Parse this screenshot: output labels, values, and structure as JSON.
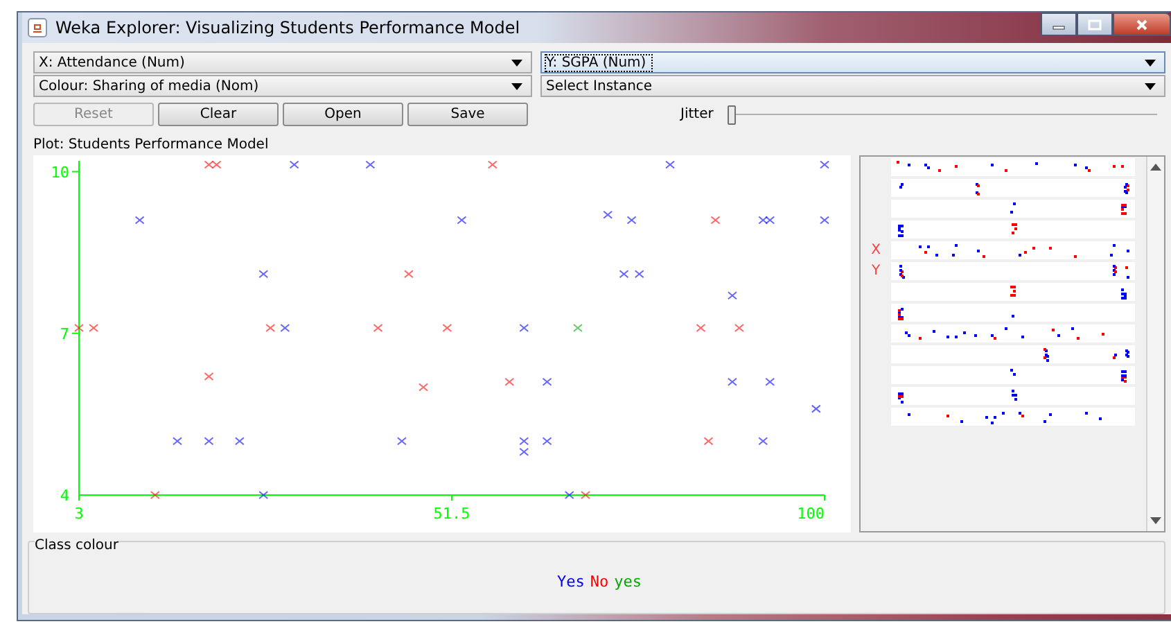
{
  "window": {
    "title": "Weka Explorer: Visualizing Students Performance Model"
  },
  "selectors": [
    {
      "kind": "dropdown",
      "value": "X: Attendance (Num)",
      "focused": false
    },
    {
      "kind": "dropdown",
      "value": "Y: SGPA (Num)",
      "focused": true
    },
    {
      "kind": "dropdown",
      "value": "Colour: Sharing of media (Nom)",
      "focused": false
    },
    {
      "kind": "dropdown",
      "value": "Select Instance",
      "focused": false
    }
  ],
  "buttons": [
    {
      "label": "Reset",
      "disabled": true
    },
    {
      "label": "Clear",
      "disabled": false
    },
    {
      "label": "Open",
      "disabled": false
    },
    {
      "label": "Save",
      "disabled": false
    }
  ],
  "jitter": {
    "label": "Jitter",
    "level": 0
  },
  "plot": {
    "title": "Plot: Students Performance Model",
    "chart_data": {
      "type": "scatter",
      "xlim": [
        3,
        100
      ],
      "ylim": [
        4,
        10.2
      ],
      "xticks": [
        {
          "value": 3,
          "label": "3"
        },
        {
          "value": 51.5,
          "label": "51.5"
        },
        {
          "value": 100,
          "label": "100"
        }
      ],
      "yticks": [
        {
          "value": 4,
          "label": "4"
        },
        {
          "value": 7,
          "label": "7"
        },
        {
          "value": 10,
          "label": "10"
        }
      ],
      "series": [
        {
          "name": "Yes",
          "color": "#0000ff",
          "x": [
            31,
            40.9,
            79.9,
            100,
            10.9,
            52.8,
            71.8,
            74.9,
            92,
            92.9,
            100,
            27,
            73.9,
            75.9,
            88,
            29.8,
            60.9,
            63.9,
            88,
            92.9,
            98.9,
            15.8,
            19.9,
            23.9,
            45,
            60.9,
            60.9,
            63.9,
            92,
            27,
            66.8
          ],
          "values": [
            10.13,
            10.13,
            10.13,
            10.13,
            9.1,
            9.1,
            9.2,
            9.1,
            9.1,
            9.1,
            9.1,
            8.1,
            8.1,
            8.1,
            7.7,
            7.1,
            7.1,
            6.1,
            6.1,
            6.1,
            5.6,
            5,
            5,
            5,
            5,
            5,
            4.8,
            5,
            5,
            4,
            4
          ]
        },
        {
          "name": "No",
          "color": "#ff0000",
          "x": [
            19.9,
            20.9,
            56.8,
            85.8,
            45.9,
            3,
            4.9,
            27.9,
            41.9,
            50.9,
            83.9,
            88.9,
            19.9,
            47.8,
            59,
            84.9,
            12.9,
            68.9
          ],
          "values": [
            10.13,
            10.13,
            10.13,
            9.1,
            8.1,
            7.1,
            7.1,
            7.1,
            7.1,
            7.1,
            7.1,
            7.1,
            6.2,
            6,
            6.1,
            5,
            4,
            4
          ]
        },
        {
          "name": "yes",
          "color": "#00a800",
          "x": [
            67.9
          ],
          "values": [
            7.1
          ]
        }
      ]
    }
  },
  "attribute_panel": {
    "x_marker": "X",
    "y_marker": "Y"
  },
  "class_colour": {
    "title": "Class colour"
  }
}
